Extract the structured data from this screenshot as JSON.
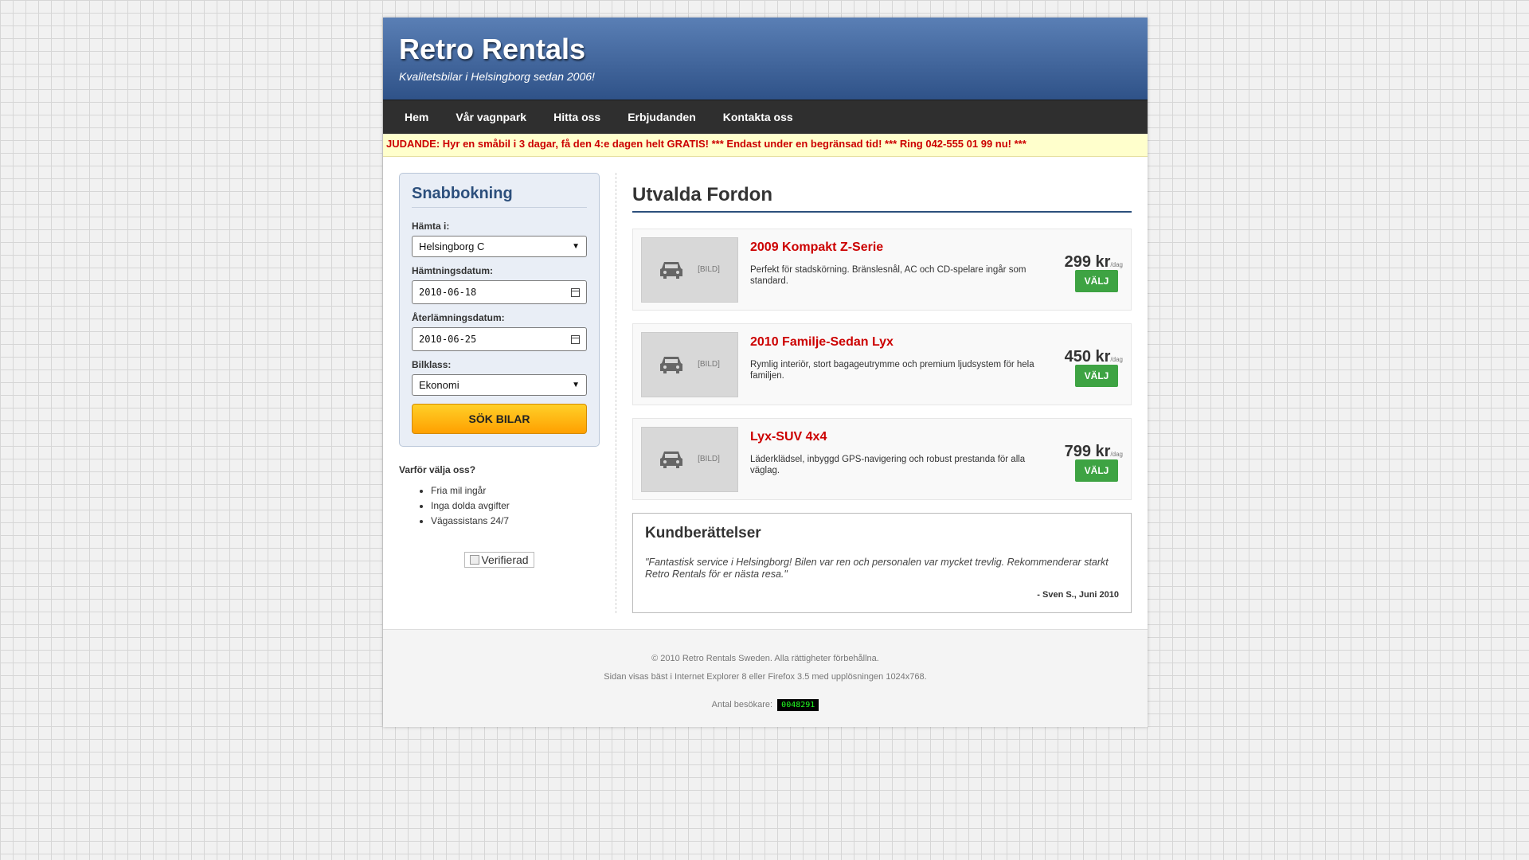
{
  "header": {
    "title": "Retro Rentals",
    "tagline": "Kvalitetsbilar i Helsingborg sedan 2006!"
  },
  "nav": {
    "items": [
      "Hem",
      "Vår vagnpark",
      "Hitta oss",
      "Erbjudanden",
      "Kontakta oss"
    ]
  },
  "ticker": "JUDANDE: Hyr en småbil i 3 dagar, få den 4:e dagen helt GRATIS! *** Endast under en begränsad tid! *** Ring 042-555 01 99 nu! ***",
  "booking": {
    "title": "Snabbokning",
    "pickup_label": "Hämta i:",
    "pickup_value": "Helsingborg C",
    "pickup_date_label": "Hämtningsdatum:",
    "pickup_date_value": "2010-06-18",
    "return_date_label": "Återlämningsdatum:",
    "return_date_value": "2010-06-25",
    "class_label": "Bilklass:",
    "class_value": "Ekonomi",
    "search_button": "SÖK BILAR"
  },
  "why": {
    "title": "Varför välja oss?",
    "items": [
      "Fria mil ingår",
      "Inga dolda avgifter",
      "Vägassistans 24/7"
    ]
  },
  "verified_alt": "Verifierad",
  "featured": {
    "title": "Utvalda Fordon",
    "image_label": "[BILD]",
    "per_day": "/dag",
    "choose_label": "VÄLJ",
    "cars": [
      {
        "name": "2009 Kompakt Z-Serie",
        "desc": "Perfekt för stadskörning. Bränslesnål, AC och CD-spelare ingår som standard.",
        "price": "299 kr"
      },
      {
        "name": "2010 Familje-Sedan Lyx",
        "desc": "Rymlig interiör, stort bagageutrymme och premium ljudsystem för hela familjen.",
        "price": "450 kr"
      },
      {
        "name": "Lyx-SUV 4x4",
        "desc": "Läderklädsel, inbyggd GPS-navigering och robust prestanda för alla väglag.",
        "price": "799 kr"
      }
    ]
  },
  "testimonials": {
    "title": "Kundberättelser",
    "quote": "\"Fantastisk service i Helsingborg! Bilen var ren och personalen var mycket trevlig. Rekommenderar starkt Retro Rentals för er nästa resa.\"",
    "author": "- Sven S., Juni 2010"
  },
  "footer": {
    "copyright": "© 2010 Retro Rentals Sweden. Alla rättigheter förbehållna.",
    "browser_note": "Sidan visas bäst i Internet Explorer 8 eller Firefox 3.5 med upplösningen 1024x768.",
    "visitors_label": "Antal besökare:",
    "visitors_count": "0048291"
  }
}
